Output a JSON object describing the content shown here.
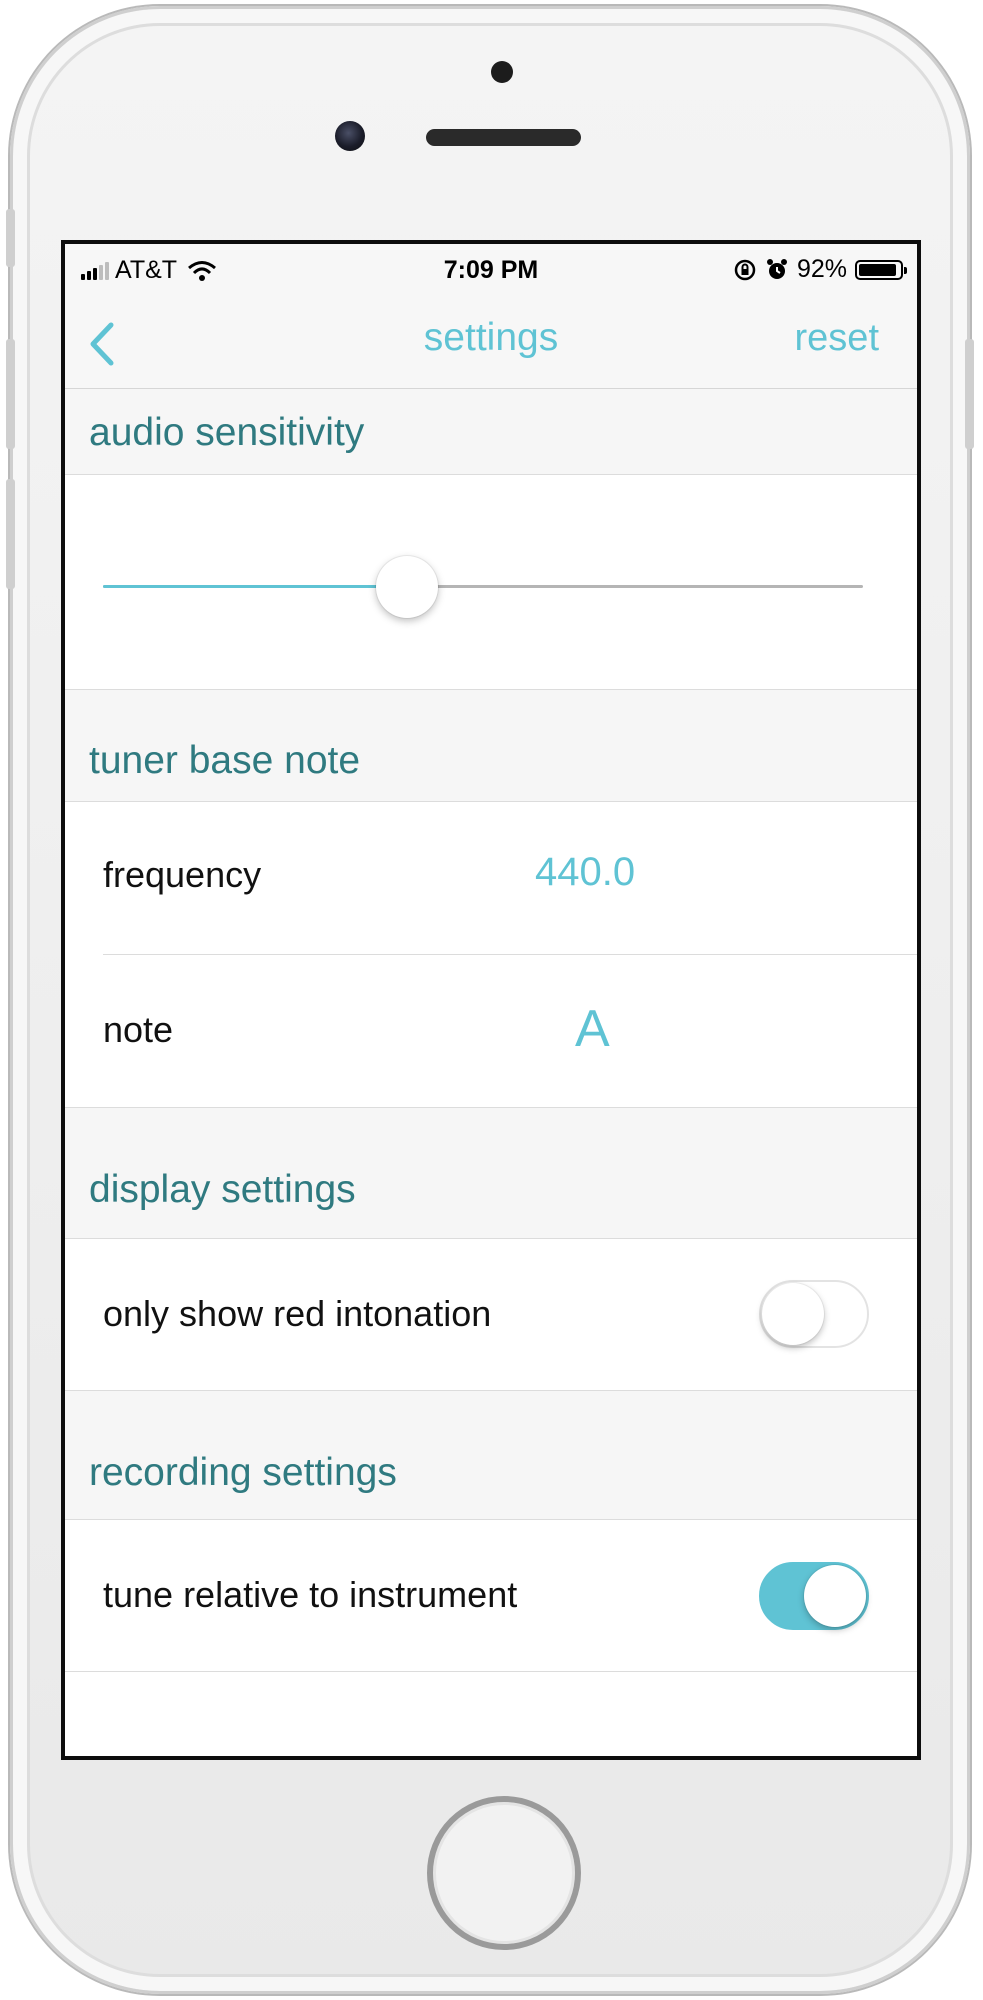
{
  "status_bar": {
    "carrier": "AT&T",
    "time": "7:09 PM",
    "battery_percent": "92%",
    "battery_level": 0.92,
    "icons": [
      "signal-icon",
      "wifi-icon",
      "orientation-lock-icon",
      "alarm-icon",
      "battery-icon"
    ]
  },
  "nav": {
    "back_icon": "chevron-left-icon",
    "title": "settings",
    "reset_label": "reset"
  },
  "sections": {
    "audio": {
      "header": "audio sensitivity",
      "slider_value": 0.4
    },
    "tuner": {
      "header": "tuner base note",
      "frequency_label": "frequency",
      "frequency_value": "440.0",
      "note_label": "note",
      "note_value": "A"
    },
    "display": {
      "header": "display settings",
      "red_intonation_label": "only show red intonation",
      "red_intonation_on": false
    },
    "recording": {
      "header": "recording settings",
      "relative_label": "tune relative to instrument",
      "relative_on": true
    }
  },
  "colors": {
    "accent": "#5fc3d4",
    "section_header_text": "#2f7a80"
  }
}
